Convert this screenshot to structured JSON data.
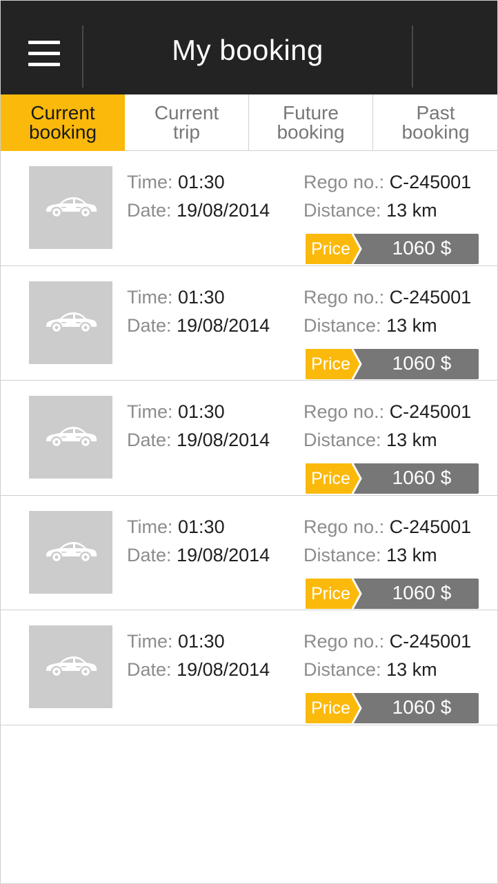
{
  "header": {
    "title": "My booking",
    "menu_icon": "hamburger-menu-icon"
  },
  "tabs": [
    {
      "label": "Current\nbooking",
      "active": true
    },
    {
      "label": "Current\ntrip",
      "active": false
    },
    {
      "label": "Future\nbooking",
      "active": false
    },
    {
      "label": "Past\nbooking",
      "active": false
    }
  ],
  "bookings": [
    {
      "time_label": "Time:",
      "time": "01:30",
      "date_label": "Date:",
      "date": "19/08/2014",
      "rego_label": "Rego no.:",
      "rego": "C-245001",
      "distance_label": "Distance:",
      "distance": "13 km",
      "price_label": "Price",
      "price": "1060 $",
      "icon": "car-icon"
    },
    {
      "time_label": "Time:",
      "time": "01:30",
      "date_label": "Date:",
      "date": "19/08/2014",
      "rego_label": "Rego no.:",
      "rego": "C-245001",
      "distance_label": "Distance:",
      "distance": "13 km",
      "price_label": "Price",
      "price": "1060 $",
      "icon": "car-icon"
    },
    {
      "time_label": "Time:",
      "time": "01:30",
      "date_label": "Date:",
      "date": "19/08/2014",
      "rego_label": "Rego no.:",
      "rego": "C-245001",
      "distance_label": "Distance:",
      "distance": "13 km",
      "price_label": "Price",
      "price": "1060 $",
      "icon": "car-icon"
    },
    {
      "time_label": "Time:",
      "time": "01:30",
      "date_label": "Date:",
      "date": "19/08/2014",
      "rego_label": "Rego no.:",
      "rego": "C-245001",
      "distance_label": "Distance:",
      "distance": "13 km",
      "price_label": "Price",
      "price": "1060 $",
      "icon": "car-icon"
    },
    {
      "time_label": "Time:",
      "time": "01:30",
      "date_label": "Date:",
      "date": "19/08/2014",
      "rego_label": "Rego no.:",
      "rego": "C-245001",
      "distance_label": "Distance:",
      "distance": "13 km",
      "price_label": "Price",
      "price": "1060 $",
      "icon": "car-icon"
    }
  ],
  "colors": {
    "header_bg": "#232323",
    "accent": "#fbb90b",
    "price_bg": "#777777",
    "thumb_bg": "#cccccc"
  }
}
